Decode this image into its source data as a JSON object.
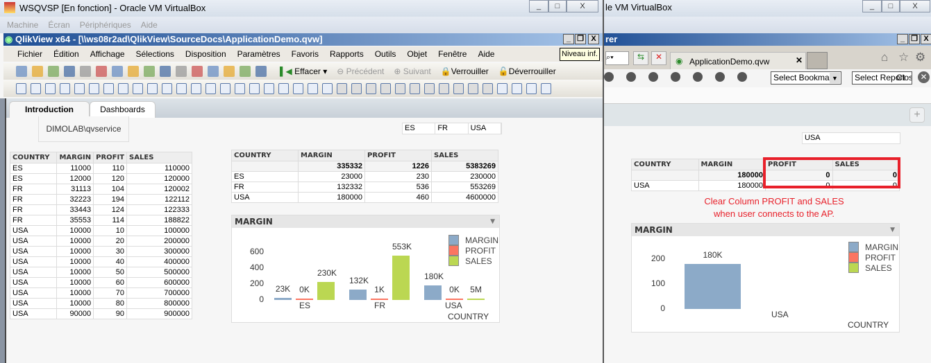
{
  "vbox_left": {
    "title": "WSQVSP [En fonction] - Oracle VM VirtualBox",
    "menu": [
      "Machine",
      "Écran",
      "Périphériques",
      "Aide"
    ]
  },
  "vbox_right": {
    "title": "le VM VirtualBox"
  },
  "qlikview": {
    "title": "QlikView x64 - [\\\\ws08r2ad\\QlikView\\SourceDocs\\ApplicationDemo.qvw]",
    "menu": [
      "Fichier",
      "Édition",
      "Affichage",
      "Sélections",
      "Disposition",
      "Paramètres",
      "Favoris",
      "Rapports",
      "Outils",
      "Objet",
      "Fenêtre",
      "Aide"
    ],
    "tooltip": "Niveau inf.",
    "toolbar1_icons": [
      "new-icon",
      "open-icon",
      "reload-icon",
      "save-icon",
      "print-icon",
      "edit-script-icon",
      "reload-data-icon",
      "undo-icon",
      "redo-icon",
      "search-icon",
      "check-icon",
      "chart-icon",
      "bookmark-icon",
      "edit-icon",
      "help-icon",
      "help-pointer-icon"
    ],
    "toolbar1_buttons": {
      "clear": "Effacer",
      "back": "Précédent",
      "forward": "Suivant",
      "lock": "Verrouiller",
      "unlock": "Déverrouiller"
    },
    "toolbar2_icons": [
      "new-sheet-icon",
      "promote-icon",
      "demote-icon",
      "sheet-props-icon",
      "listbox-icon",
      "statistics-icon",
      "table-icon",
      "multibox-icon",
      "chart-icon",
      "input-icon",
      "checkbox-icon",
      "button-icon",
      "text-icon",
      "line-icon",
      "slider-icon",
      "bookmark-object-icon",
      "search-object-icon",
      "container-icon",
      "custom-object-icon",
      "wizard-icon",
      "format-painter-icon",
      "select-icon",
      "align-left-icon",
      "align-center-icon",
      "align-right-icon",
      "align-bottom-icon",
      "align-middle-icon",
      "align-top-icon",
      "distribute-h-icon",
      "distribute-v-icon",
      "space-h-icon",
      "space-v-icon",
      "adjust-icon",
      "server-icon",
      "doc-props-icon",
      "note-icon",
      "share-icon"
    ],
    "tabs": [
      "Introduction",
      "Dashboards"
    ],
    "user": "DIMOLAB\\qvservice",
    "listbox": [
      "ES",
      "FR",
      "USA"
    ],
    "detail_table": {
      "headers": [
        "COUNTRY",
        "MARGIN",
        "PROFIT",
        "SALES"
      ],
      "rows": [
        [
          "ES",
          "11000",
          "110",
          "110000"
        ],
        [
          "ES",
          "12000",
          "120",
          "120000"
        ],
        [
          "FR",
          "31113",
          "104",
          "120002"
        ],
        [
          "FR",
          "32223",
          "194",
          "122112"
        ],
        [
          "FR",
          "33443",
          "124",
          "122333"
        ],
        [
          "FR",
          "35553",
          "114",
          "188822"
        ],
        [
          "USA",
          "10000",
          "10",
          "100000"
        ],
        [
          "USA",
          "10000",
          "20",
          "200000"
        ],
        [
          "USA",
          "10000",
          "30",
          "300000"
        ],
        [
          "USA",
          "10000",
          "40",
          "400000"
        ],
        [
          "USA",
          "10000",
          "50",
          "500000"
        ],
        [
          "USA",
          "10000",
          "60",
          "600000"
        ],
        [
          "USA",
          "10000",
          "70",
          "700000"
        ],
        [
          "USA",
          "10000",
          "80",
          "800000"
        ],
        [
          "USA",
          "90000",
          "90",
          "900000"
        ]
      ]
    },
    "summary_table": {
      "headers": [
        "COUNTRY",
        "MARGIN",
        "PROFIT",
        "SALES"
      ],
      "totals": [
        "",
        "335332",
        "1226",
        "5383269"
      ],
      "rows": [
        [
          "ES",
          "23000",
          "230",
          "230000"
        ],
        [
          "FR",
          "132332",
          "536",
          "553269"
        ],
        [
          "USA",
          "180000",
          "460",
          "4600000"
        ]
      ]
    }
  },
  "web": {
    "title": "rer",
    "tab": "ApplicationDemo.qvw",
    "bookmark_select": "Select Bookmark",
    "report_select": "Select Report",
    "close_label": "Close",
    "plus": "+",
    "toolbar_icons": [
      "clear-icon",
      "edit-icon",
      "chart-icon",
      "add-icon",
      "pin-icon",
      "add-bookmark-icon",
      "remove-bookmark-icon"
    ],
    "listbox": "USA",
    "table": {
      "headers": [
        "COUNTRY",
        "MARGIN",
        "PROFIT",
        "SALES"
      ],
      "totals": [
        "",
        "180000",
        "0",
        "0"
      ],
      "rows": [
        [
          "USA",
          "180000",
          "0",
          "0"
        ]
      ]
    },
    "annotation": [
      "Clear Column PROFIT and SALES",
      "when user connects to the AP."
    ],
    "annotation_color": "#e8202a"
  },
  "chart_data": [
    {
      "type": "bar",
      "title": "MARGIN",
      "categories": [
        "ES",
        "FR",
        "USA"
      ],
      "xlabel": "COUNTRY",
      "ylim": [
        0,
        600
      ],
      "yticks": [
        "600",
        "400",
        "200",
        "0"
      ],
      "ytick_values": [
        600,
        400,
        200,
        0
      ],
      "legend": "top-right",
      "series": [
        {
          "name": "MARGIN",
          "color": "#8caac8",
          "values": [
            23,
            132,
            180
          ],
          "labels": [
            "23K",
            "132K",
            "180K"
          ]
        },
        {
          "name": "PROFIT",
          "color": "#fb7561",
          "values": [
            0,
            1,
            0
          ],
          "labels": [
            "0K",
            "1K",
            "0K"
          ]
        },
        {
          "name": "SALES",
          "color": "#bbd752",
          "values": [
            230,
            553,
            4600
          ],
          "labels": [
            "230K",
            "553K",
            "5M"
          ]
        }
      ]
    },
    {
      "type": "bar",
      "title": "MARGIN",
      "categories": [
        "USA"
      ],
      "xlabel": "COUNTRY",
      "ylim": [
        0,
        200
      ],
      "yticks": [
        "200",
        "100",
        "0"
      ],
      "ytick_values": [
        200,
        100,
        0
      ],
      "legend": "top-right",
      "series": [
        {
          "name": "MARGIN",
          "color": "#8caac8",
          "values": [
            180
          ],
          "labels": [
            "180K"
          ]
        },
        {
          "name": "PROFIT",
          "color": "#fb7561",
          "values": [
            null
          ],
          "labels": [
            ""
          ]
        },
        {
          "name": "SALES",
          "color": "#bbd752",
          "values": [
            null
          ],
          "labels": [
            ""
          ]
        }
      ]
    }
  ]
}
